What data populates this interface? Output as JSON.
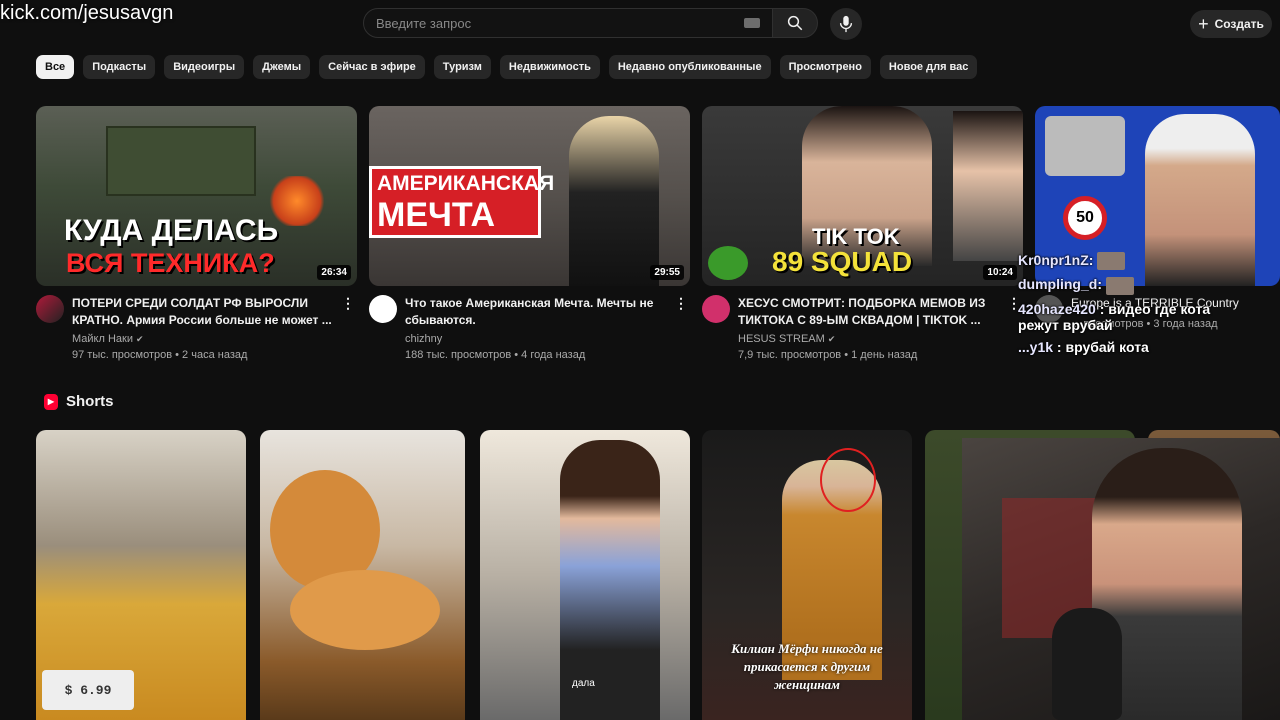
{
  "overlay_url": "kick.com/jesusavgn",
  "search": {
    "placeholder": "Введите запрос"
  },
  "header": {
    "create_label": "Создать"
  },
  "chips": [
    "Все",
    "Подкасты",
    "Видеоигры",
    "Джемы",
    "Сейчас в эфире",
    "Туризм",
    "Недвижимость",
    "Недавно опубликованные",
    "Просмотрено",
    "Новое для вас"
  ],
  "videos": [
    {
      "thumb_line1": "КУДА ДЕЛАСЬ",
      "thumb_line2": "ВСЯ ТЕХНИКА?",
      "duration": "26:34",
      "title": "ПОТЕРИ СРЕДИ СОЛДАТ РФ ВЫРОСЛИ КРАТНО. Армия России больше не может ...",
      "channel": "Майкл Наки",
      "stats": "97 тыс. просмотров • 2 часа назад",
      "verified": true
    },
    {
      "thumb_line1": "АМЕРИКАНСКАЯ",
      "thumb_line2": "МЕЧТА",
      "duration": "29:55",
      "title": "Что такое Американская Мечта. Мечты не сбываются.",
      "channel": "chizhny",
      "stats": "188 тыс. просмотров • 4 года назад",
      "verified": false
    },
    {
      "thumb_line1": "TIK TOK",
      "thumb_line2": "89 SQUAD",
      "duration": "10:24",
      "title": "ХЕСУС СМОТРИТ: ПОДБОРКА МЕМОВ ИЗ ТИКТОКА С 89-ЫМ СКВАДОМ | ТIKTOK ...",
      "channel": "HESUS STREAM",
      "stats": "7,9 тыс. просмотров • 1 день назад",
      "verified": true
    },
    {
      "thumb_line1": "50",
      "title": "Europe is a TERRIBLE Country",
      "stats": "... просмотров • 3 года назад"
    }
  ],
  "shorts": {
    "heading": "Shorts",
    "items": [
      {
        "price_tag": "$ 6.99"
      },
      {},
      {
        "caption_small": "дала"
      },
      {
        "caption": "Килиан Мёрфи никогда не прикасается к другим женщинам"
      },
      {}
    ]
  },
  "chat": [
    {
      "user": "Kr0npr1nZ",
      "message": ":"
    },
    {
      "user": "dumpling_d",
      "message": ":"
    },
    {
      "user": "420haze420",
      "message": ": видео где кота режут врубай"
    },
    {
      "user": "...y1k",
      "message": ": врубай кота"
    }
  ],
  "colors": {
    "background": "#0f0f0f",
    "chip": "#272727",
    "chip_active": "#f1f1f1",
    "brand_red": "#ff0033"
  }
}
